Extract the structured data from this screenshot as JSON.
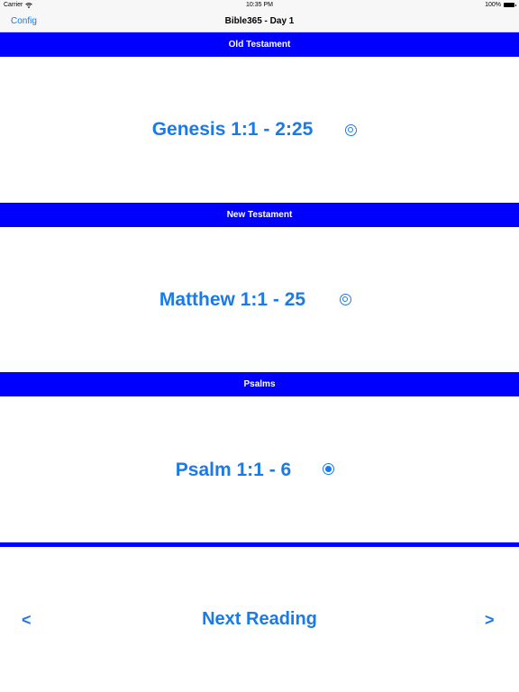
{
  "status_bar": {
    "carrier": "Carrier",
    "time": "10:35 PM",
    "battery": "100%"
  },
  "nav": {
    "left_button": "Config",
    "title": "Bible365 - Day 1"
  },
  "sections": [
    {
      "header": "Old Testament",
      "reading": "Genesis 1:1 - 2:25",
      "checked": false
    },
    {
      "header": "New Testament",
      "reading": "Matthew 1:1 - 25",
      "checked": false
    },
    {
      "header": "Psalms",
      "reading": "Psalm 1:1 - 6",
      "checked": true
    }
  ],
  "footer": {
    "prev": "<",
    "next_reading": "Next Reading",
    "next": ">"
  },
  "colors": {
    "accent": "#1a7ae8",
    "section_bg": "#0000ff"
  }
}
